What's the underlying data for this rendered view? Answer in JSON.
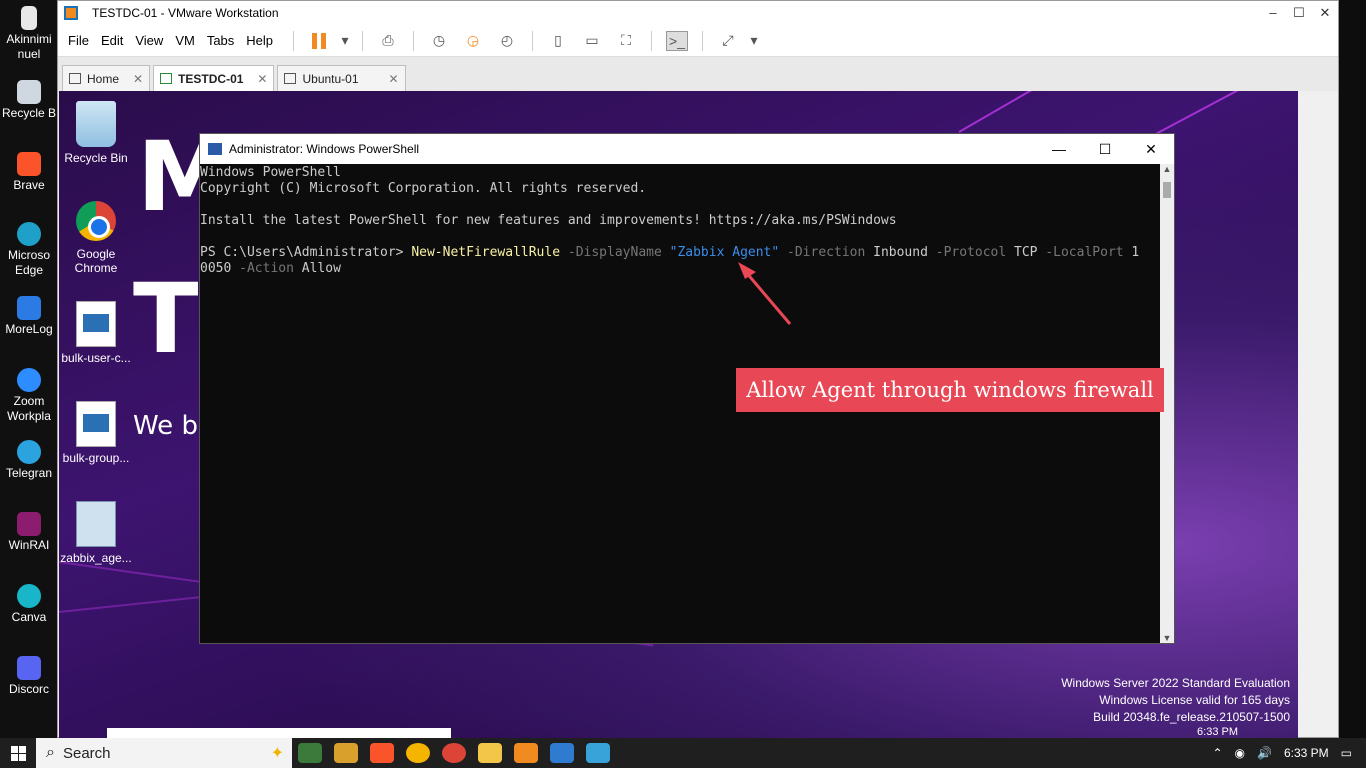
{
  "host": {
    "desktop_icons": [
      {
        "label": "Akinnimi\nnuel",
        "icon": "folder-icon"
      },
      {
        "label": "Recycle B",
        "icon": "recycle-bin-icon"
      },
      {
        "label": "Brave",
        "icon": "brave-icon"
      },
      {
        "label": "Microso\nEdge",
        "icon": "edge-icon"
      },
      {
        "label": "MoreLog",
        "icon": "morelogin-icon"
      },
      {
        "label": "Zoom\nWorkpla",
        "icon": "zoom-icon"
      },
      {
        "label": "Telegran",
        "icon": "telegram-icon"
      },
      {
        "label": "WinRAI",
        "icon": "winrar-icon"
      },
      {
        "label": "Canva",
        "icon": "canva-icon"
      },
      {
        "label": "Discorc",
        "icon": "discord-icon"
      }
    ],
    "taskbar": {
      "search_placeholder": "Search",
      "time": "6:33 PM"
    }
  },
  "vmware": {
    "title": "TESTDC-01 - VMware Workstation",
    "menu": [
      "File",
      "Edit",
      "View",
      "VM",
      "Tabs",
      "Help"
    ],
    "tabs": [
      {
        "label": "Home",
        "active": false
      },
      {
        "label": "TESTDC-01",
        "active": true
      },
      {
        "label": "Ubuntu-01",
        "active": false
      }
    ],
    "close_glyph": "✕"
  },
  "guest": {
    "desktop_icons": [
      {
        "label": "Recycle Bin",
        "icon": "recycle-bin-icon"
      },
      {
        "label": "Google\nChrome",
        "icon": "chrome-icon"
      },
      {
        "label": "bulk-user-c...",
        "icon": "powershell-script-icon"
      },
      {
        "label": "bulk-group...",
        "icon": "powershell-script-icon"
      },
      {
        "label": "zabbix_age...",
        "icon": "installer-icon"
      }
    ],
    "wallpaper_text": {
      "line1": "M",
      "line2": "T",
      "line3": "We b"
    },
    "watermark": {
      "line1": "Windows Server 2022 Standard Evaluation",
      "line2": "Windows License valid for 165 days",
      "line3": "Build 20348.fe_release.210507-1500"
    },
    "tray_time": "6:33 PM"
  },
  "powershell": {
    "title": "Administrator: Windows PowerShell",
    "lines": {
      "l1": "Windows PowerShell",
      "l2": "Copyright (C) Microsoft Corporation. All rights reserved.",
      "l3": "Install the latest PowerShell for new features and improvements! https://aka.ms/PSWindows",
      "prompt": "PS C:\\Users\\Administrator> ",
      "cmdlet": "New-NetFirewallRule",
      "p_displayname": " -DisplayName ",
      "v_displayname": "\"Zabbix Agent\"",
      "p_direction": " -Direction ",
      "v_direction": "Inbound",
      "p_protocol": " -Protocol ",
      "v_protocol": "TCP",
      "p_localport": " -LocalPort ",
      "v_localport_a": "1",
      "v_localport_b": "0050",
      "p_action": " -Action ",
      "v_action": "Allow"
    }
  },
  "annotation": {
    "callout_text": "Allow Agent through windows firewall",
    "callout_color": "#e84856"
  }
}
